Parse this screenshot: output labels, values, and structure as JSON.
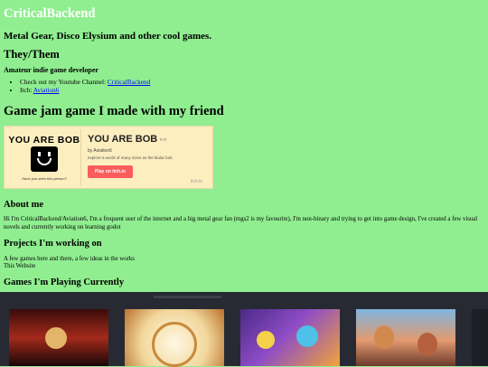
{
  "site": {
    "title": "CriticalBackend",
    "tagline": "Metal Gear, Disco Elysium and other cool games.",
    "pronouns": "They/Them",
    "role": "Amateur indie game developer"
  },
  "links": [
    {
      "prefix": "Check out my Youtube Channel: ",
      "label": "CriticalBackend"
    },
    {
      "prefix": "Itch: ",
      "label": "Aviation6"
    }
  ],
  "jam": {
    "heading": "Game jam game I made with my friend",
    "card": {
      "thumb_title": "YOU ARE BOB",
      "thumb_caption": "Have you seen this person?",
      "title": "YOU ARE BOB",
      "badge": "¤ ¤",
      "author_prefix": "by ",
      "author": "Aviation6",
      "description": "explore a world of many sizes as the titular bob",
      "play_label": "Play on itch.io",
      "logo": "itch.io"
    }
  },
  "about": {
    "heading": "About me",
    "text": "Hi I'm CriticalBackend/Aviation6, I'm a frequent user of the internet and a big metal gear fan (mgs2 is my favourite), I'm non-binary and trying to get into game design, I've created a few visual novels and currently working on learning godot"
  },
  "projects": {
    "heading": "Projects I'm working on",
    "line1": "A few games here and there, a few ideas in the works",
    "line2": "This Website"
  },
  "playing": {
    "heading": "Games I'm Playing Currently"
  },
  "colors": {
    "page_background": "#90ee90",
    "title_color": "#ffffff",
    "panel_background": "#272a33",
    "card_background": "#fdeebf",
    "play_button": "#fa5c5c"
  }
}
